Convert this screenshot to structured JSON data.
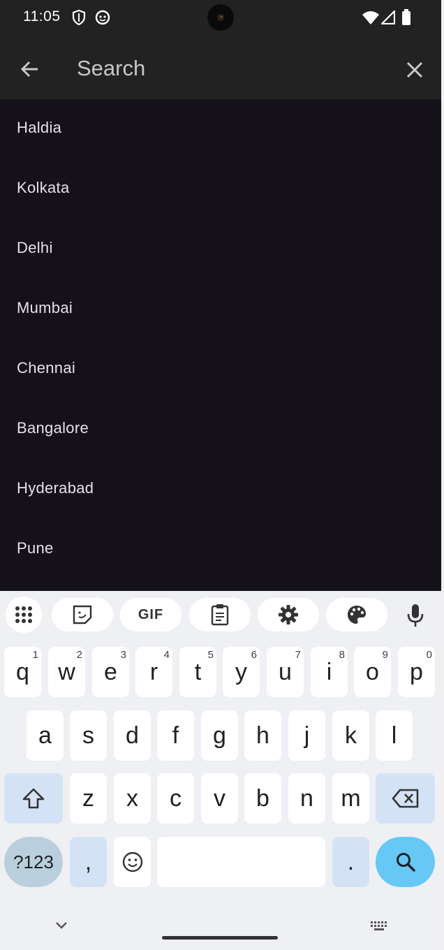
{
  "status_bar": {
    "time": "11:05"
  },
  "app_bar": {
    "search_placeholder": "Search"
  },
  "cities": [
    "Haldia",
    "Kolkata",
    "Delhi",
    "Mumbai",
    "Chennai",
    "Bangalore",
    "Hyderabad",
    "Pune"
  ],
  "keyboard": {
    "toolbar": {
      "gif_label": "GIF"
    },
    "row1": [
      {
        "key": "q",
        "hint": "1"
      },
      {
        "key": "w",
        "hint": "2"
      },
      {
        "key": "e",
        "hint": "3"
      },
      {
        "key": "r",
        "hint": "4"
      },
      {
        "key": "t",
        "hint": "5"
      },
      {
        "key": "y",
        "hint": "6"
      },
      {
        "key": "u",
        "hint": "7"
      },
      {
        "key": "i",
        "hint": "8"
      },
      {
        "key": "o",
        "hint": "9"
      },
      {
        "key": "p",
        "hint": "0"
      }
    ],
    "row2": [
      "a",
      "s",
      "d",
      "f",
      "g",
      "h",
      "j",
      "k",
      "l"
    ],
    "row3": [
      "z",
      "x",
      "c",
      "v",
      "b",
      "n",
      "m"
    ],
    "symbols_label": "?123",
    "comma": ",",
    "period": "."
  },
  "colors": {
    "app_bar_bg": "#222222",
    "list_bg": "#141218",
    "keyboard_bg": "#eff0f4",
    "search_key": "#65c8f5"
  }
}
